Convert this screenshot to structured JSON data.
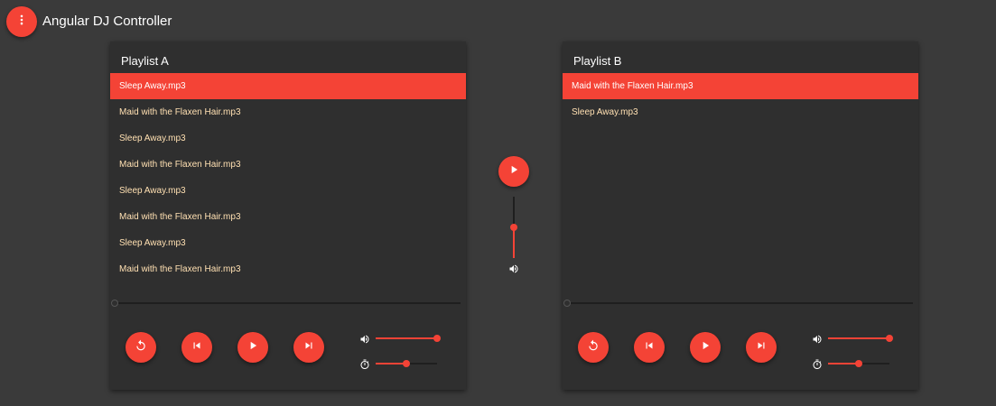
{
  "app": {
    "title": "Angular DJ Controller",
    "menu_icon": "more-vert-icon"
  },
  "colors": {
    "accent": "#f44336",
    "background": "#3a3a3a",
    "card": "#2f2f2f",
    "track_text": "#ffe0b2"
  },
  "center": {
    "play_icon": "play-icon",
    "crossfader_level": 0.5,
    "volume_icon": "volume-icon"
  },
  "deck_a": {
    "title": "Playlist A",
    "tracks": [
      "Sleep Away.mp3",
      "Maid with the Flaxen Hair.mp3",
      "Sleep Away.mp3",
      "Maid with the Flaxen Hair.mp3",
      "Sleep Away.mp3",
      "Maid with the Flaxen Hair.mp3",
      "Sleep Away.mp3",
      "Maid with the Flaxen Hair.mp3"
    ],
    "selected_index": 0,
    "progress": 0,
    "volume_level": 1.0,
    "speed_level": 0.5,
    "controls": [
      "replay-icon",
      "skip-previous-icon",
      "play-icon",
      "skip-next-icon"
    ]
  },
  "deck_b": {
    "title": "Playlist B",
    "tracks": [
      "Maid with the Flaxen Hair.mp3",
      "Sleep Away.mp3"
    ],
    "selected_index": 0,
    "progress": 0,
    "volume_level": 1.0,
    "speed_level": 0.5,
    "controls": [
      "replay-icon",
      "skip-previous-icon",
      "play-icon",
      "skip-next-icon"
    ]
  }
}
